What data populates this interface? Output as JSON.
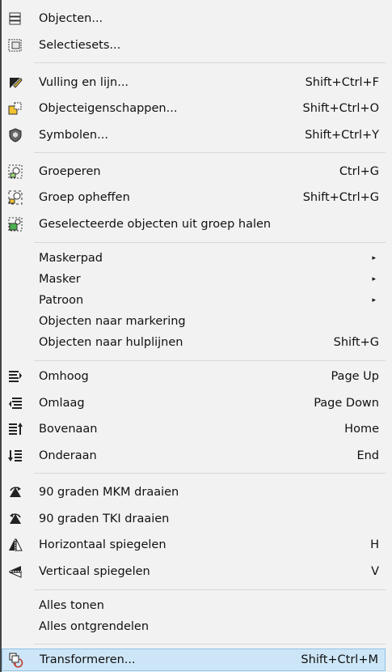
{
  "menu": {
    "objecten": {
      "label": "Objecten...",
      "shortcut": ""
    },
    "selectiesets": {
      "label": "Selectiesets...",
      "shortcut": ""
    },
    "vulling": {
      "label": "Vulling en lijn...",
      "shortcut": "Shift+Ctrl+F"
    },
    "objecteigenschappen": {
      "label": "Objecteigenschappen...",
      "shortcut": "Shift+Ctrl+O"
    },
    "symbolen": {
      "label": "Symbolen...",
      "shortcut": "Shift+Ctrl+Y"
    },
    "groeperen": {
      "label": "Groeperen",
      "shortcut": "Ctrl+G"
    },
    "groep_opheffen": {
      "label": "Groep opheffen",
      "shortcut": "Shift+Ctrl+G"
    },
    "uit_groep": {
      "label": "Geselecteerde objecten uit groep halen",
      "shortcut": ""
    },
    "maskerpad": {
      "label": "Maskerpad",
      "submenu": "▸"
    },
    "masker": {
      "label": "Masker",
      "submenu": "▸"
    },
    "patroon": {
      "label": "Patroon",
      "submenu": "▸"
    },
    "naar_markering": {
      "label": "Objecten naar markering",
      "shortcut": ""
    },
    "naar_hulplijnen": {
      "label": "Objecten naar hulplijnen",
      "shortcut": "Shift+G"
    },
    "omhoog": {
      "label": "Omhoog",
      "shortcut": "Page Up"
    },
    "omlaag": {
      "label": "Omlaag",
      "shortcut": "Page Down"
    },
    "bovenaan": {
      "label": "Bovenaan",
      "shortcut": "Home"
    },
    "onderaan": {
      "label": "Onderaan",
      "shortcut": "End"
    },
    "mkm": {
      "label": "90 graden MKM draaien",
      "shortcut": ""
    },
    "tki": {
      "label": "90 graden TKI draaien",
      "shortcut": ""
    },
    "horizontaal": {
      "label": "Horizontaal spiegelen",
      "shortcut": "H"
    },
    "verticaal": {
      "label": "Verticaal spiegelen",
      "shortcut": "V"
    },
    "alles_tonen": {
      "label": "Alles tonen",
      "shortcut": ""
    },
    "alles_ontgrendelen": {
      "label": "Alles ontgrendelen",
      "shortcut": ""
    },
    "transformeren": {
      "label": "Transformeren...",
      "shortcut": "Shift+Ctrl+M"
    }
  },
  "colors": {
    "menu_bg": "#f2f2f2",
    "highlight": "#cde6f7",
    "highlight_border": "#8ec2e8",
    "separator": "#d7d7d7"
  }
}
